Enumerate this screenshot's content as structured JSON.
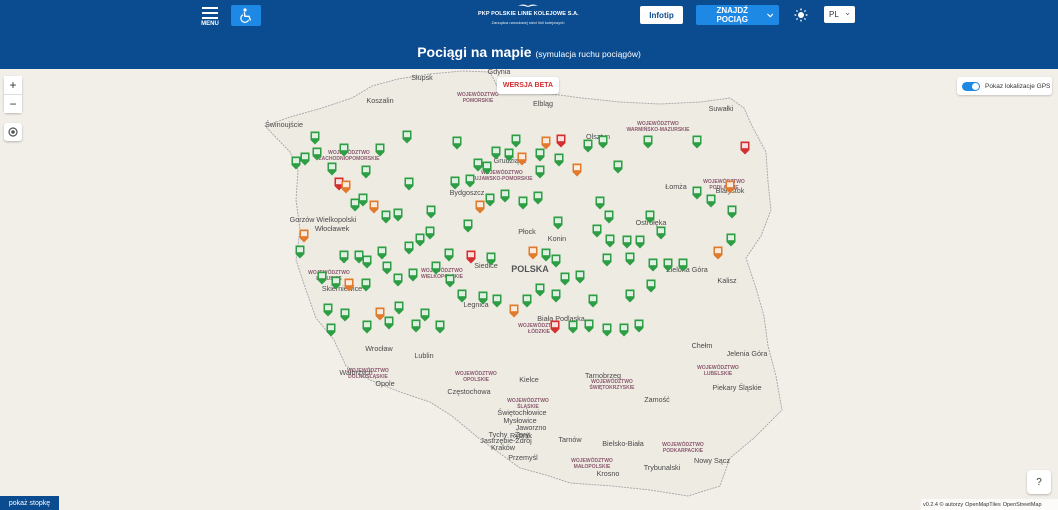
{
  "header": {
    "menu_label": "MENU",
    "logo_name": "PKP POLSKIE LINIE KOLEJOWE S.A.",
    "logo_tagline": "Zarządca narodowej sieci linii kolejowych",
    "infotip_label": "Infotip",
    "find_train_label": "ZNAJDŹ POCIĄG",
    "language": "PL",
    "title": "Pociągi na mapie",
    "subtitle": "(symulacja ruchu pociągów)",
    "accent_color": "#0b4b8f"
  },
  "map": {
    "zoom_in": "+",
    "zoom_out": "−",
    "beta_badge": "WERSJA BETA",
    "gps_label": "Pokaz lokalizacje GPS",
    "help_label": "?",
    "footer_button": "pokaż stopkę",
    "attribution": "v0.2.4 © autorzy",
    "attribution_links": [
      "OpenMapTiles",
      "OpenStreetMap"
    ],
    "country_label": "POLSKA",
    "cities": [
      "Słupsk",
      "Gdynia",
      "Koszalin",
      "Elbląg",
      "Suwałki",
      "Świnoujście",
      "Olsztyn",
      "Grudziądz",
      "Łomża",
      "Białystok",
      "Bydgoszcz",
      "Ostrołęka",
      "Gorzów Wielkopolski",
      "Włocławek",
      "Płock",
      "Konin",
      "Siedlce",
      "Zielona Góra",
      "Skierniewice",
      "Biała Podlaska",
      "Kalisz",
      "Legnica",
      "Wrocław",
      "Lublin",
      "Chełm",
      "Jelenia Góra",
      "Wałbrzych",
      "Opole",
      "Częstochowa",
      "Kielce",
      "Tarnobrzeg",
      "Zamość",
      "Piekary Śląskie",
      "Świętochłowice",
      "Mysłowice",
      "Jaworzno",
      "Rybnik",
      "Tychy",
      "Żory",
      "Jastrzębie-Zdrój",
      "Kraków",
      "Tarnów",
      "Bielsko-Biała",
      "Przemyśl",
      "Nowy Sącz",
      "Krosno",
      "Trybunalski"
    ],
    "regions": [
      [
        "WOJEWÓDZTWO",
        "POMORSKIE"
      ],
      [
        "WOJEWÓDZTWO",
        "WARMIŃSKO-MAZURSKIE"
      ],
      [
        "WOJEWÓDZTWO",
        "ZACHODNIOPOMORSKIE"
      ],
      [
        "WOJEWÓDZTWO",
        "KUJAWSKO-POMORSKIE"
      ],
      [
        "WOJEWÓDZTWO",
        "PODLASKIE"
      ],
      [
        "WOJEWÓDZTWO",
        "LUBUSKIE"
      ],
      [
        "WOJEWÓDZTWO",
        "WIELKOPOLSKIE"
      ],
      [
        "WOJEWÓDZTWO",
        "ŁÓDZKIE"
      ],
      [
        "WOJEWÓDZTWO",
        "DOLNOŚLĄSKIE"
      ],
      [
        "WOJEWÓDZTWO",
        "OPOLSKIE"
      ],
      [
        "WOJEWÓDZTWO",
        "ŚLĄSKIE"
      ],
      [
        "WOJEWÓDZTWO",
        "ŚWIĘTOKRZYSKIE"
      ],
      [
        "WOJEWÓDZTWO",
        "LUBELSKIE"
      ],
      [
        "WOJEWÓDZTWO",
        "MAŁOPOLSKIE"
      ],
      [
        "WOJEWÓDZTWO",
        "PODKARPACKIE"
      ]
    ],
    "marker_colors": {
      "on_time": "#2e9e44",
      "delayed": "#e07a2c",
      "cancelled": "#d32f2f"
    }
  }
}
